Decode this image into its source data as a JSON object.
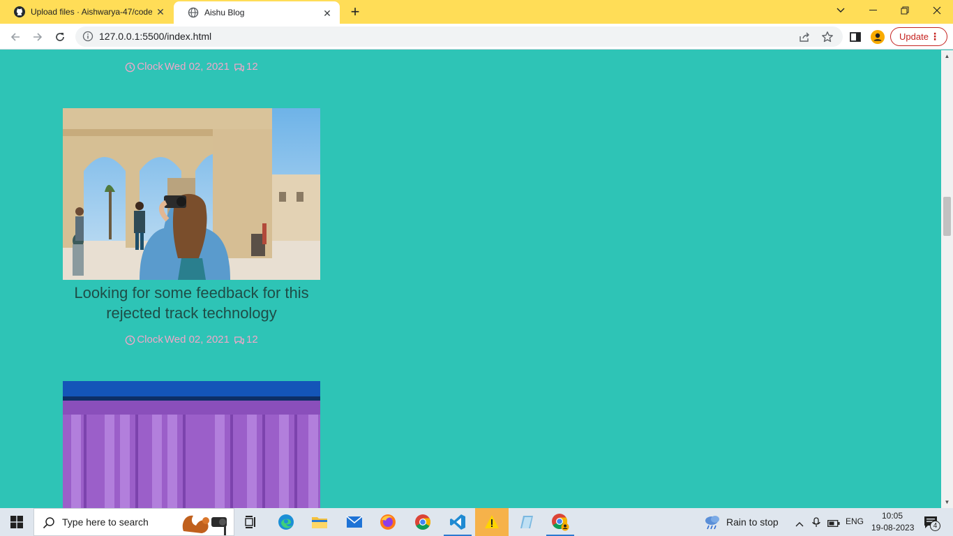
{
  "browser": {
    "tabs": [
      {
        "title": "Upload files · Aishwarya-47/code",
        "icon": "github-icon"
      },
      {
        "title": "Aishu Blog",
        "icon": "globe-icon"
      }
    ],
    "url": "127.0.0.1:5500/index.html",
    "update_label": "Update"
  },
  "posts": [
    {
      "meta": {
        "clock_label": "Clock",
        "date": "Wed 02, 2021",
        "comments": "12"
      }
    },
    {
      "title": "Looking for some feedback for this rejected track technology",
      "meta": {
        "clock_label": "Clock",
        "date": "Wed 02, 2021",
        "comments": "12"
      }
    }
  ],
  "taskbar": {
    "search_placeholder": "Type here to search",
    "weather": "Rain to stop",
    "language": "ENG",
    "time": "10:05",
    "date": "19-08-2023",
    "notifications": "4"
  },
  "colors": {
    "page_background": "#2ec4b6",
    "tab_strip": "#ffdd57",
    "meta_pink": "#f2a7c9",
    "title_text": "#1e4d47"
  }
}
